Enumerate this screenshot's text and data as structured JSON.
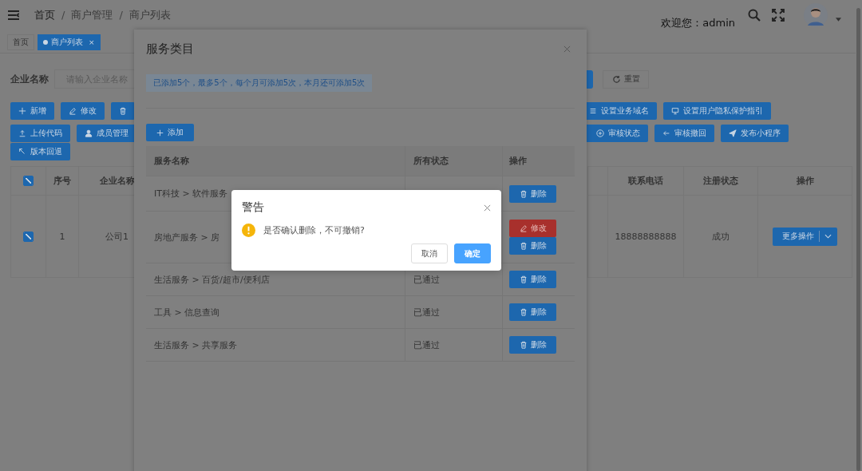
{
  "header": {
    "breadcrumb": [
      {
        "kind": "link",
        "text": "首页"
      },
      {
        "kind": "separator",
        "text": "/"
      },
      {
        "kind": "item",
        "text": "商户管理"
      },
      {
        "kind": "separator",
        "text": "/"
      },
      {
        "kind": "item",
        "text": "商户列表"
      }
    ],
    "welcome": "欢迎您：admin"
  },
  "tabs": [
    {
      "label": "首页",
      "selected": false
    },
    {
      "label": "商户列表",
      "selected": true,
      "close": "×"
    }
  ],
  "search": {
    "label": "企业名称",
    "placeholder": "请输入企业名称",
    "reset": "重置"
  },
  "toolbar_left": [
    [
      {
        "kind": "labeled",
        "label": "新增"
      },
      {
        "kind": "labeled",
        "label": "修改"
      },
      {
        "kind": "icon_only"
      }
    ],
    [
      {
        "kind": "labeled",
        "label": "上传代码"
      },
      {
        "kind": "labeled",
        "label": "成员管理"
      }
    ],
    [
      {
        "kind": "labeled",
        "label": "版本回退"
      }
    ]
  ],
  "toolbar_right": [
    [
      {
        "label": "设置业务域名"
      },
      {
        "label": "设置用户隐私保护指引"
      }
    ],
    [
      {
        "label": "审核状态"
      },
      {
        "label": "审核撤回"
      },
      {
        "label": "发布小程序"
      }
    ]
  ],
  "table": {
    "header_checked": true,
    "left_columns": [
      "序号",
      "企业名称"
    ],
    "right_columns": [
      "联系电话",
      "注册状态",
      "操作"
    ],
    "rows": [
      {
        "checked": true,
        "index": "1",
        "company": "公司1",
        "phone": "18888888888",
        "status": "成功",
        "action": "更多操作"
      }
    ]
  },
  "dialog": {
    "title": "服务类目",
    "notice": "已添加5个，最多5个，每个月可添加5次，本月还可添加5次",
    "add": "添加",
    "columns": [
      "服务名称",
      "所有状态",
      "操作"
    ],
    "rows": [
      {
        "name": "IT科技 > 软件服务",
        "actions": [
          {
            "kind": "delete",
            "label": "删除"
          }
        ]
      },
      {
        "name": "房地产服务 > 房",
        "actions": [
          {
            "kind": "edit",
            "label": "修改"
          },
          {
            "kind": "delete",
            "label": "删除"
          }
        ]
      },
      {
        "name": "生活服务 > 百货/超市/便利店",
        "status": "已通过",
        "actions": [
          {
            "kind": "delete",
            "label": "删除"
          }
        ]
      },
      {
        "name": "工具 > 信息查询",
        "status": "已通过",
        "actions": [
          {
            "kind": "delete",
            "label": "删除"
          }
        ]
      },
      {
        "name": "生活服务 > 共享服务",
        "status": "已通过",
        "actions": [
          {
            "kind": "delete",
            "label": "删除"
          }
        ]
      }
    ]
  },
  "alert": {
    "title": "警告",
    "message": "是否确认删除，不可撤销?",
    "buttons": [
      {
        "label": "取消",
        "kind": "default"
      },
      {
        "label": "确定",
        "kind": "primary"
      }
    ]
  }
}
